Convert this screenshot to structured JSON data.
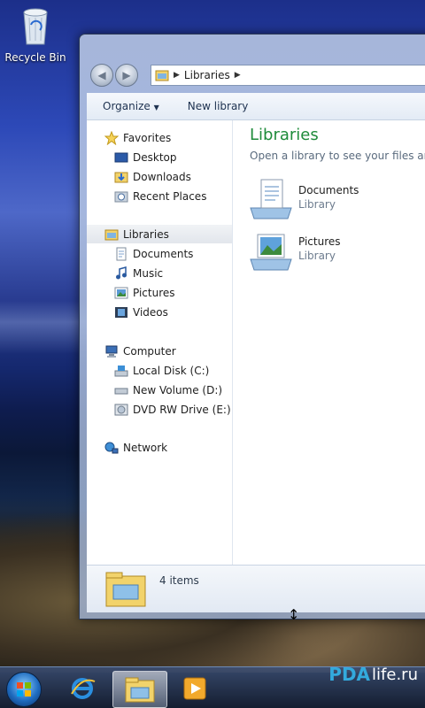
{
  "desktop": {
    "recycle_bin_label": "Recycle Bin"
  },
  "window": {
    "address": {
      "segments": [
        "Libraries"
      ]
    },
    "toolbar": {
      "organize_label": "Organize",
      "new_library_label": "New library"
    },
    "nav": {
      "favorites": {
        "label": "Favorites",
        "items": [
          "Desktop",
          "Downloads",
          "Recent Places"
        ]
      },
      "libraries": {
        "label": "Libraries",
        "items": [
          "Documents",
          "Music",
          "Pictures",
          "Videos"
        ]
      },
      "computer": {
        "label": "Computer",
        "items": [
          "Local Disk (C:)",
          "New Volume (D:)",
          "DVD RW Drive (E:) O"
        ]
      },
      "network": {
        "label": "Network"
      }
    },
    "content": {
      "title": "Libraries",
      "subtitle": "Open a library to see your files and a",
      "libraries": [
        {
          "name": "Documents",
          "type": "Library"
        },
        {
          "name": "Pictures",
          "type": "Library"
        }
      ]
    },
    "details": {
      "count": "4 items"
    }
  },
  "watermark": {
    "brand": "PDA",
    "suffix": "life.ru"
  },
  "colors": {
    "title_green": "#1e8b3a",
    "selection": "#e2e6ec"
  }
}
